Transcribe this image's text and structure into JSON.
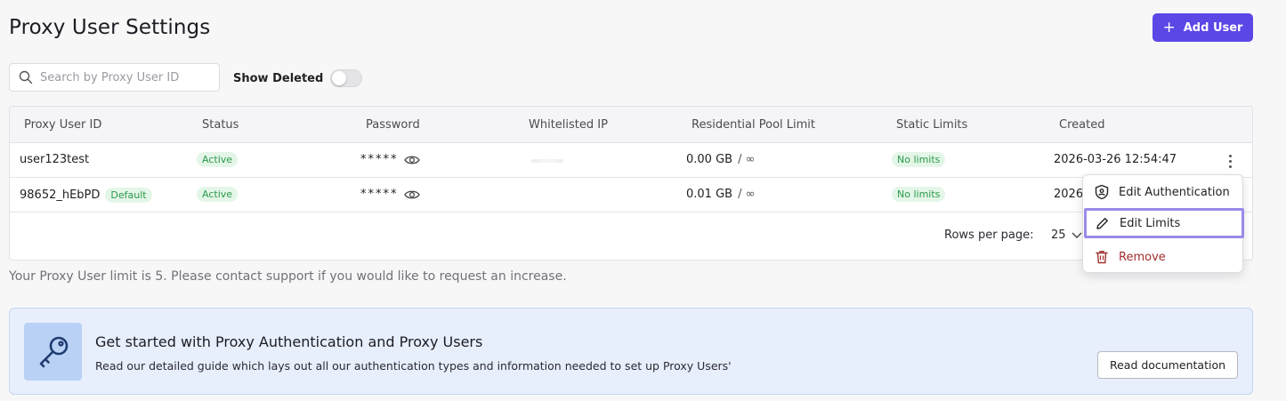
{
  "page": {
    "title": "Proxy User Settings",
    "add_user_label": "Add User",
    "add_icon": "plus-icon"
  },
  "search": {
    "placeholder": "Search by Proxy User ID",
    "value": ""
  },
  "show_deleted": {
    "label": "Show Deleted",
    "on": false
  },
  "table": {
    "columns": [
      "Proxy User ID",
      "Status",
      "Password",
      "Whitelisted IP",
      "Residential Pool Limit",
      "Static Limits",
      "Created"
    ],
    "rows": [
      {
        "id": "user123test",
        "default_badge": "",
        "status": "Active",
        "password": "*****",
        "whitelisted_ip": "",
        "pool_value": "0.00 GB",
        "pool_sep": "/ ∞",
        "static": "No limits",
        "created": "2026-03-26 12:54:47"
      },
      {
        "id": "98652_hEbPD",
        "default_badge": "Default",
        "status": "Active",
        "password": "*****",
        "whitelisted_ip": "",
        "pool_value": "0.01 GB",
        "pool_sep": "/ ∞",
        "static": "No limits",
        "created": "2026"
      }
    ],
    "rows_per_page_label": "Rows per page:",
    "rows_per_page_value": "25"
  },
  "limit_note": "Your Proxy User limit is 5. Please contact support if you would like to request an increase.",
  "menu": {
    "items": [
      {
        "label": "Edit Authentication",
        "icon": "shield-icon"
      },
      {
        "label": "Edit Limits",
        "icon": "pencil-icon"
      },
      {
        "label": "Remove",
        "icon": "trash-icon"
      }
    ]
  },
  "banner": {
    "title": "Get started with Proxy Authentication and Proxy Users",
    "description": "Read our detailed guide which lays out all our authentication types and information needed to set up Proxy Users'",
    "button_label": "Read documentation",
    "icon": "key-icon"
  },
  "colors": {
    "accent": "#5b47e6",
    "active_badge": "#2a9a4a",
    "danger": "#a22d2d",
    "menu_highlight": "#9b8ae8",
    "banner_bg": "#e7eefc"
  }
}
